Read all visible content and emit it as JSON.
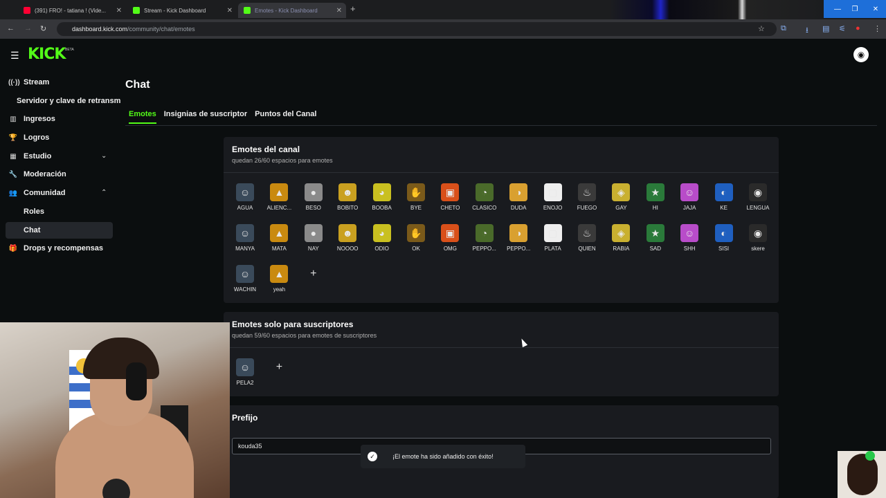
{
  "browser": {
    "tabs": [
      {
        "title": "(391) FRO! - tatiana ! (Vide...",
        "favicon_color": "#ff0033"
      },
      {
        "title": "Stream - Kick Dashboard",
        "favicon_color": "#53fc18"
      },
      {
        "title": "Emotes - Kick Dashboard",
        "favicon_color": "#53fc18"
      }
    ],
    "url_host": "dashboard.kick.com",
    "url_path": "/community/chat/emotes"
  },
  "app": {
    "logo": "KICK",
    "beta": "BETA",
    "accent_color": "#53fc18"
  },
  "sidebar": {
    "items": [
      {
        "label": "Stream",
        "icon": "broadcast-icon"
      },
      {
        "label": "Servidor y clave de retransm",
        "sub": true
      },
      {
        "label": "Ingresos",
        "icon": "chart-icon"
      },
      {
        "label": "Logros",
        "icon": "trophy-icon"
      },
      {
        "label": "Estudio",
        "icon": "layout-icon"
      },
      {
        "label": "Moderación",
        "icon": "wrench-icon"
      },
      {
        "label": "Comunidad",
        "icon": "people-icon"
      },
      {
        "label": "Roles",
        "sub": true
      },
      {
        "label": "Chat",
        "sub": true,
        "active": true
      },
      {
        "label": "Drops y recompensas",
        "icon": "gift-icon"
      }
    ]
  },
  "main": {
    "title": "Chat",
    "tabs": [
      "Emotes",
      "Insignias de suscriptor",
      "Puntos del Canal"
    ],
    "channel_emotes": {
      "title": "Emotes del canal",
      "subtitle": "quedan 26/60 espacios para emotes",
      "emotes": [
        "AGUA",
        "ALIENC...",
        "BESO",
        "BOBITO",
        "BOOBA",
        "BYE",
        "CHETO",
        "CLASICO",
        "DUDA",
        "ENOJO",
        "FUEGO",
        "GAY",
        "HI",
        "JAJA",
        "KE",
        "LENGUA",
        "MANYA",
        "MATA",
        "NAY",
        "NOOOO",
        "ODIO",
        "OK",
        "OMG",
        "PEPPO...",
        "PEPPO...",
        "PLATA",
        "QUIEN",
        "RABIA",
        "SAD",
        "SHH",
        "SISI",
        "skere",
        "WACHIN",
        "yeah"
      ]
    },
    "sub_emotes": {
      "title": "Emotes solo para suscriptores",
      "subtitle": "quedan 59/60 espacios para emotes de suscriptores",
      "emotes": [
        "PELA2"
      ]
    },
    "prefix": {
      "title": "Prefijo",
      "value": "kouda35"
    },
    "toast": "¡El emote ha sido añadido con éxito!"
  }
}
